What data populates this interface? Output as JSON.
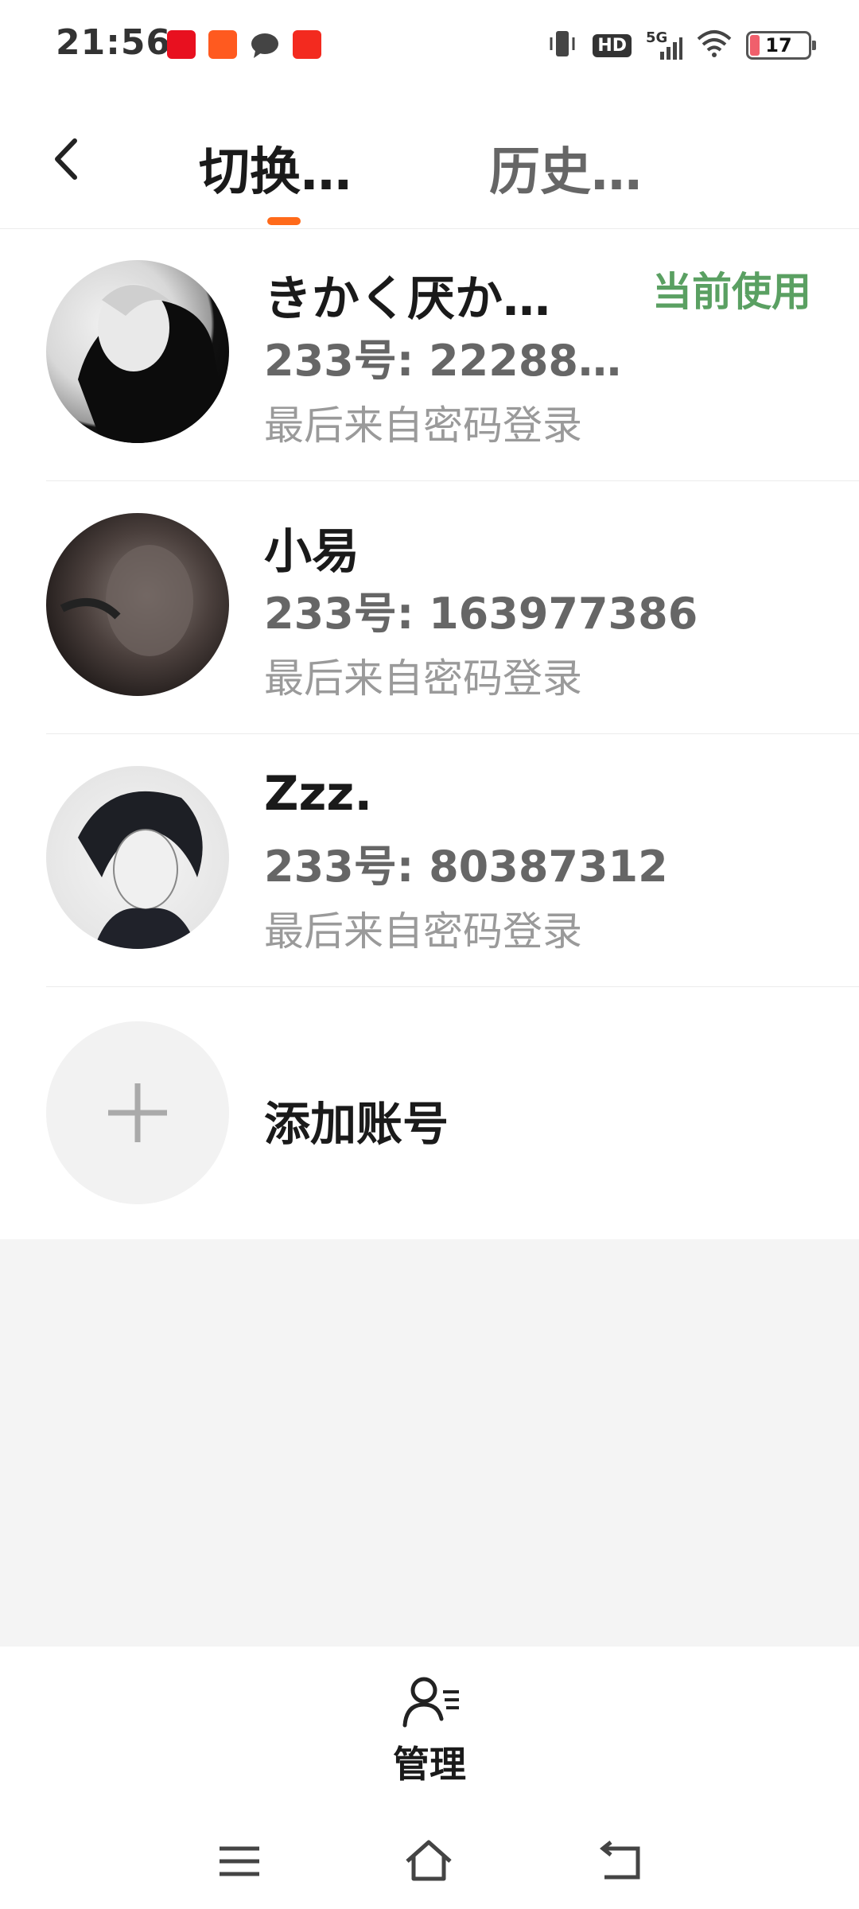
{
  "status_bar": {
    "time": "21:56",
    "hd": "HD",
    "network": "5G",
    "battery": "17",
    "battery_level": 0.17,
    "icons": [
      "notification-app-icon",
      "video-app-icon",
      "message-icon",
      "shopping-app-icon",
      "vibrate-icon",
      "wifi-icon"
    ]
  },
  "header": {
    "back_icon": "back-arrow-icon",
    "tabs": [
      {
        "label": "切换…",
        "active": true
      },
      {
        "label": "历史…",
        "active": false
      }
    ],
    "accent_color": "#ff6a1a"
  },
  "accounts": [
    {
      "name": "きかく厌か…",
      "id_text": "233号: 22288…",
      "login_text": "最后来自密码登录",
      "status": "当前使用"
    },
    {
      "name": "小易",
      "id_text": "233号: 163977386",
      "login_text": "最后来自密码登录",
      "status": ""
    },
    {
      "name": "Zzz.",
      "id_text": "233号: 80387312",
      "login_text": "最后来自密码登录",
      "status": ""
    }
  ],
  "add_account": {
    "label": "添加账号",
    "icon": "plus-icon"
  },
  "bottom_bar": {
    "label": "管理",
    "icon": "manage-user-icon"
  },
  "system_nav": {
    "menu_icon": "menu-icon",
    "home_icon": "home-icon",
    "back_icon": "back-nav-icon"
  },
  "colors": {
    "current_status": "#5aa062",
    "indicator": "#ff6a1a"
  }
}
